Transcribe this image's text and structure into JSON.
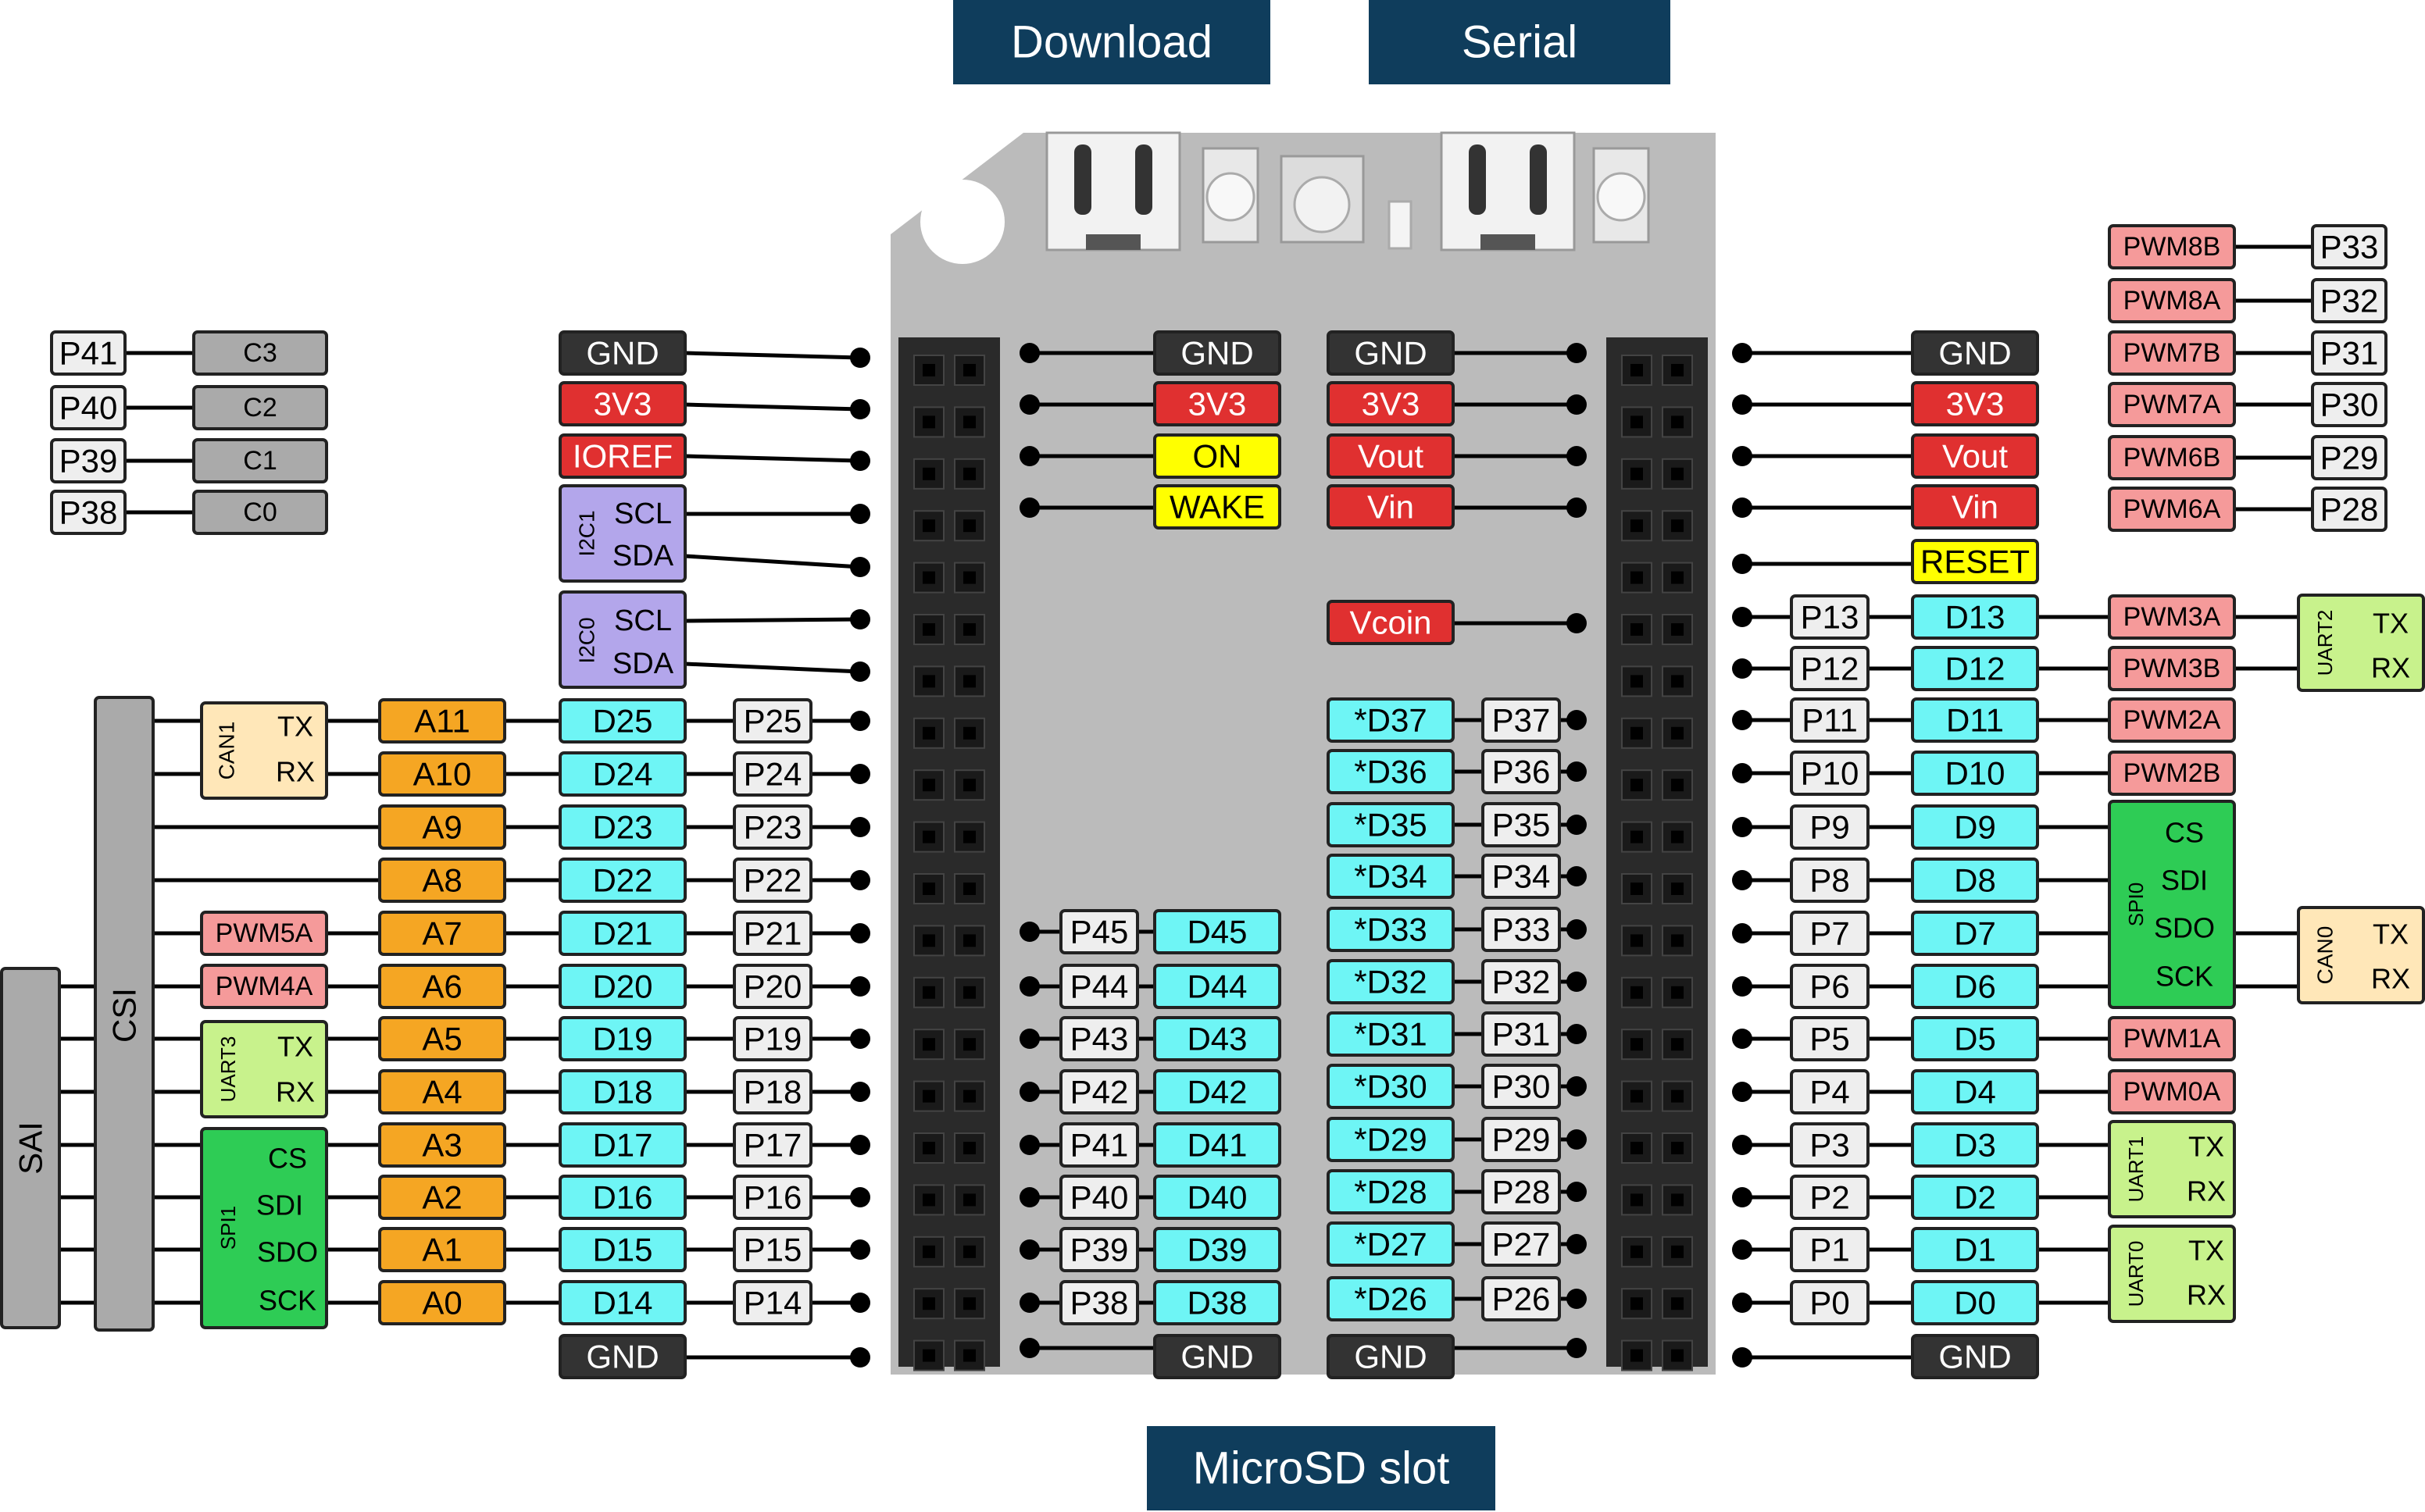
{
  "buttons": {
    "download": "Download",
    "serial": "Serial",
    "microsd": "MicroSD slot"
  },
  "colors": {
    "gnd": "#333333",
    "power": "#e03030",
    "yellow": "#ffff00",
    "cyan": "#6ef5f5",
    "white_pin": "#eeeeee",
    "gray_box": "#aaaaaa",
    "orange": "#f5a623",
    "pink": "#f59a9a",
    "purple": "#b3a6eb",
    "green": "#2ecc55",
    "lightgreen": "#c8f28c",
    "beige": "#ffe7b8",
    "button_bg": "#0f3d5c",
    "board": "#bbbbbb",
    "header": "#2a2a2a"
  },
  "labels": {
    "gnd": "GND",
    "v3": "3V3",
    "ioref": "IOREF",
    "on": "ON",
    "wake": "WAKE",
    "vout": "Vout",
    "vin": "Vin",
    "vcoin": "Vcoin",
    "reset": "RESET",
    "tx": "TX",
    "rx": "RX",
    "scl": "SCL",
    "sda": "SDA",
    "cs": "CS",
    "sdi": "SDI",
    "sdo": "SDO",
    "sck": "SCK",
    "i2c1": "I2C1",
    "i2c0": "I2C0",
    "can1": "CAN1",
    "can0": "CAN0",
    "uart0": "UART0",
    "uart1": "UART1",
    "uart2": "UART2",
    "uart3": "UART3",
    "spi0": "SPI0",
    "spi1": "SPI1",
    "sai": "SAI",
    "csi": "CSI"
  },
  "camera": {
    "pins": [
      "P41",
      "P40",
      "P39",
      "P38"
    ],
    "signals": [
      "C3",
      "C2",
      "C1",
      "C0"
    ]
  },
  "left_header": {
    "digital": [
      "D25",
      "D24",
      "D23",
      "D22",
      "D21",
      "D20",
      "D19",
      "D18",
      "D17",
      "D16",
      "D15",
      "D14"
    ],
    "pins": [
      "P25",
      "P24",
      "P23",
      "P22",
      "P21",
      "P20",
      "P19",
      "P18",
      "P17",
      "P16",
      "P15",
      "P14"
    ],
    "analog": [
      "A11",
      "A10",
      "A9",
      "A8",
      "A7",
      "A6",
      "A5",
      "A4",
      "A3",
      "A2",
      "A1",
      "A0"
    ],
    "pwm": [
      "PWM5A",
      "PWM4A"
    ]
  },
  "center_left": {
    "pins": [
      "P45",
      "P44",
      "P43",
      "P42",
      "P41",
      "P40",
      "P39",
      "P38"
    ],
    "digital": [
      "D45",
      "D44",
      "D43",
      "D42",
      "D41",
      "D40",
      "D39",
      "D38"
    ]
  },
  "center_right": {
    "digital": [
      "*D37",
      "*D36",
      "*D35",
      "*D34",
      "*D33",
      "*D32",
      "*D31",
      "*D30",
      "*D29",
      "*D28",
      "*D27",
      "*D26"
    ],
    "pins": [
      "P37",
      "P36",
      "P35",
      "P34",
      "P33",
      "P32",
      "P31",
      "P30",
      "P29",
      "P28",
      "P27",
      "P26"
    ]
  },
  "right_header": {
    "pins": [
      "P13",
      "P12",
      "P11",
      "P10",
      "P9",
      "P8",
      "P7",
      "P6",
      "P5",
      "P4",
      "P3",
      "P2",
      "P1",
      "P0"
    ],
    "digital": [
      "D13",
      "D12",
      "D11",
      "D10",
      "D9",
      "D8",
      "D7",
      "D6",
      "D5",
      "D4",
      "D3",
      "D2",
      "D1",
      "D0"
    ],
    "pwm": [
      "PWM3A",
      "PWM3B",
      "PWM2A",
      "PWM2B",
      "PWM1A",
      "PWM0A"
    ]
  },
  "pwm_top": {
    "pwm": [
      "PWM8B",
      "PWM8A",
      "PWM7B",
      "PWM7A",
      "PWM6B",
      "PWM6A"
    ],
    "pins": [
      "P33",
      "P32",
      "P31",
      "P30",
      "P29",
      "P28"
    ]
  }
}
